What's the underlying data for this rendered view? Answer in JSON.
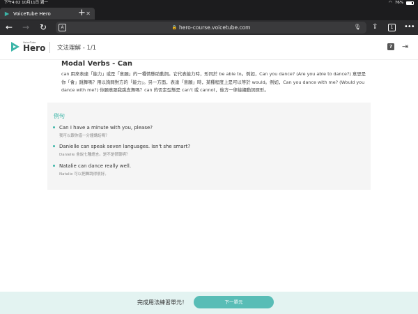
{
  "status_bar": {
    "time": "下午4:02",
    "date": "10月11日 週一",
    "battery": "76%",
    "battery_level": 0.76
  },
  "browser": {
    "tab_title": "VoiceTube Hero",
    "url": "hero-course.voicetube.com",
    "tab_count": "1"
  },
  "app": {
    "logo_small": "VoiceTube",
    "logo_big": "Hero",
    "section_title": "文法理解 - 1/1"
  },
  "lesson": {
    "title": "Modal Verbs - Can",
    "body": "can 用來表達「能力」或是「意願」的一種情態助動詞。它代表能力時，形同於 be able to。例如，Can you dance? (Are you able to dance?) 意思是你「會」跳舞嗎？用以詢問對方的「能力」。另一方面，表達「意願」時，某種程度上是可以等於 would。例如，Can you dance with me? (Would you dance with me?) 你願意跟我跳支舞嗎？can 的否定型態是 can't 或 cannot，後方一律接續動詞原形。"
  },
  "examples": {
    "title": "例句",
    "items": [
      {
        "en": "Can I have a minute with you, please?",
        "zh": "我可以跟你借一分鐘講話嗎？"
      },
      {
        "en": "Danielle can speak seven languages. Isn't she smart?",
        "zh": "Danielle 會說七種語言。是不是很聰明？"
      },
      {
        "en": "Natalie can dance really well.",
        "zh": "Natalie 可以把舞跳得很好。"
      }
    ]
  },
  "footer": {
    "message": "完成用法練習單元！",
    "next_label": "下一單元"
  },
  "colors": {
    "accent": "#3cb5a8",
    "button": "#58bdb6",
    "footer_bg": "#e3f3f1"
  }
}
